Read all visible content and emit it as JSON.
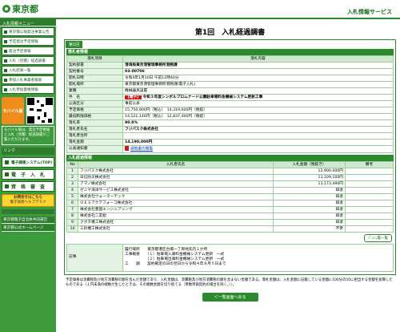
{
  "header": {
    "logo_text": "東京都",
    "service_title": "入札情報サービス"
  },
  "sidebar": {
    "head": "入札情報メニュー",
    "items": [
      {
        "label": "東京都公報発注事業公告"
      },
      {
        "label": "予定発注予定情報"
      },
      {
        "label": "発注予定情報"
      },
      {
        "label": "入札（見積）経過調書"
      },
      {
        "label": "入札結果一覧"
      },
      {
        "label": "参加入札事業者検索"
      },
      {
        "label": "入札参加資格情報"
      }
    ],
    "mobile_label": "モバイル版",
    "mobile_note": "モバイル版は、発注予定情報と入札（見積）経過調書がご覧いただけます。",
    "links_head": "リンク",
    "big_items": [
      {
        "label": "電子調達システム(TOP)"
      },
      {
        "label": "電　子　入　札"
      },
      {
        "label": "資　格　審　査"
      }
    ],
    "help_label": "お問合せはこちら",
    "help_sub": "電子調達ヘルプデスク",
    "bottom_links": [
      {
        "label": "東京都電子自治体共同運営"
      },
      {
        "label": "東京都公式ホームページ"
      }
    ]
  },
  "main": {
    "title": "第1回　入札経過調書",
    "tab_label": "第1回",
    "summary_head": "落札者情報",
    "summary_col_item": "落札項目",
    "summary_col_content": "落札内容",
    "rows": [
      {
        "label": "契約部署",
        "value": "港湾局東京港管理事務所港務課"
      },
      {
        "label": "契約番号",
        "value": "03-00706"
      },
      {
        "label": "開札日時",
        "value": "令和4年1月10日 午前11時40分"
      },
      {
        "label": "開札場所",
        "value": "東京都東京港管理事務所港務課(電子入札)"
      },
      {
        "label": "業種",
        "value": "機械器具設置"
      }
    ],
    "subject_label": "件　名",
    "subject_tag": "電子",
    "subject_text": "令和３年度シンボルプロムナード公園駐車場料金機械システム更新工事",
    "rows2": [
      {
        "label": "公表区分",
        "value": "事前公表"
      },
      {
        "label": "予定価格",
        "value": "15,750,900円（税込）　14,319,000円（税抜）"
      },
      {
        "label": "最低制限価格",
        "value": "14,121,146円（税込）　12,837,400円（税抜）"
      },
      {
        "label": "落札率",
        "value": "90.0%"
      },
      {
        "label": "落札者氏名",
        "value": "フジパスク株式会社"
      },
      {
        "label": "落札者住所",
        "value": ""
      },
      {
        "label": "落札金額",
        "value": "14,190,000円"
      }
    ],
    "notice_label": "公表通知書",
    "notice_link": "通知書の閲覧",
    "bidders_head": "入札経過情報",
    "bidders_cols": {
      "no": "No",
      "name": "入札者氏名",
      "amount": "入札金額（税抜き）",
      "note": "備考"
    },
    "bidders": [
      {
        "no": "1",
        "name": "フジパスク株式会社",
        "amount": "12,900,000円",
        "note": ""
      },
      {
        "no": "2",
        "name": "日信防災株式会社",
        "amount": "13,109,100円",
        "note": ""
      },
      {
        "no": "3",
        "name": "アマノ株式会社",
        "amount": "13,173,490円",
        "note": ""
      },
      {
        "no": "4",
        "name": "ゼニヤ海洋サービス株式会社",
        "amount": "辞退",
        "note": ""
      },
      {
        "no": "5",
        "name": "株式会社ウォーターテック",
        "amount": "辞退",
        "note": ""
      },
      {
        "no": "6",
        "name": "ＯＥＳアクアフォーコ株式会社",
        "amount": "辞退",
        "note": ""
      },
      {
        "no": "7",
        "name": "株式会社豊国エンジニアリング",
        "amount": "辞退",
        "note": ""
      },
      {
        "no": "8",
        "name": "株式会社二友組",
        "amount": "辞退",
        "note": ""
      },
      {
        "no": "9",
        "name": "クボタ機工株式会社",
        "amount": "辞退",
        "note": ""
      },
      {
        "no": "10",
        "name": "三鈴機工株式会社",
        "amount": "不参",
        "note": ""
      }
    ],
    "history_button": "ﾊﾞｯｼｭ履一覧",
    "remarks_label": "記事",
    "remarks": "履行場所　　東京都港区台場一丁目地先内１か所\n工事概要　　（１）駐車場入庫料金機械システム更新　一式\n　　　　　　（２）駐車場出庫料金機械システム更新　一式\n工　　期　　契約確定の日の翌日から令和４年８月５日まで",
    "footnote": "予定価格は消費税及び地方消費税の額を含んだ金額であり、入札金額は、消費税及び地方消費税の額を含まない金額である。落札金額は、入札金額に記載している金額に100分の10に相当する金額を加算したものである（１円未満の端数が生じたときは、その端数金額を切り捨てる（単数単価契約の場合を除く。））。",
    "back_button": "＜一覧画面へ戻る"
  }
}
